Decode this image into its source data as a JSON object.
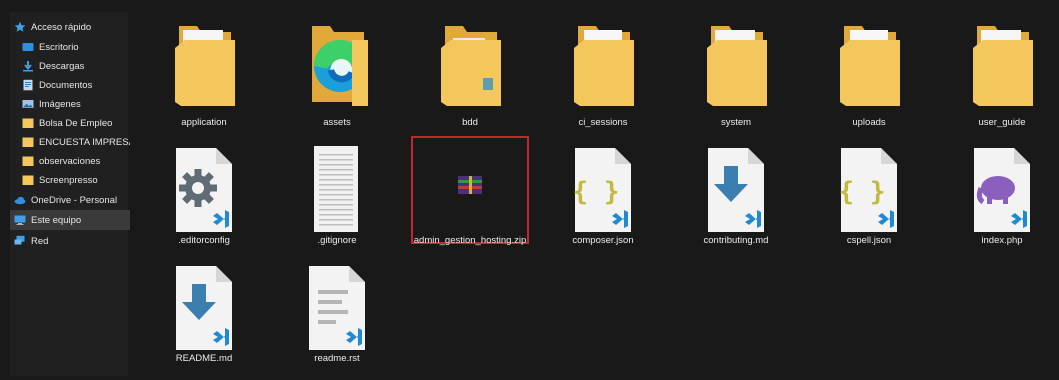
{
  "sidebar": {
    "items": [
      {
        "label": "Acceso rápido",
        "icon": "star-icon",
        "pinned": false
      },
      {
        "label": "Escritorio",
        "icon": "desktop-folder-icon",
        "pinned": true
      },
      {
        "label": "Descargas",
        "icon": "download-folder-icon",
        "pinned": true
      },
      {
        "label": "Documentos",
        "icon": "documents-folder-icon",
        "pinned": true
      },
      {
        "label": "Imágenes",
        "icon": "pictures-folder-icon",
        "pinned": true
      },
      {
        "label": "Bolsa De Empleo",
        "icon": "folder-icon",
        "pinned": false
      },
      {
        "label": "ENCUESTA IMPRESA",
        "icon": "folder-icon",
        "pinned": false
      },
      {
        "label": "observaciones",
        "icon": "folder-icon",
        "pinned": false
      },
      {
        "label": "Screenpresso",
        "icon": "folder-icon",
        "pinned": false
      },
      {
        "label": "OneDrive - Personal",
        "icon": "cloud-icon",
        "pinned": false
      },
      {
        "label": "Este equipo",
        "icon": "computer-icon",
        "pinned": false,
        "selected": true
      },
      {
        "label": "Red",
        "icon": "network-icon",
        "pinned": false
      }
    ],
    "pin_glyph": "✱"
  },
  "files": [
    {
      "name": "application",
      "type": "folder-edge"
    },
    {
      "name": "assets",
      "type": "folder-edge-big"
    },
    {
      "name": "bdd",
      "type": "folder-doc"
    },
    {
      "name": "ci_sessions",
      "type": "folder-plain"
    },
    {
      "name": "system",
      "type": "folder-edge"
    },
    {
      "name": "uploads",
      "type": "folder-plain"
    },
    {
      "name": "user_guide",
      "type": "folder-edge"
    },
    {
      "name": ".editorconfig",
      "type": "file-gear"
    },
    {
      "name": ".gitignore",
      "type": "file-text"
    },
    {
      "name": "admin_gestion_hosting.zip",
      "type": "winrar",
      "selected": true
    },
    {
      "name": "composer.json",
      "type": "file-json"
    },
    {
      "name": "contributing.md",
      "type": "file-md"
    },
    {
      "name": "cspell.json",
      "type": "file-json"
    },
    {
      "name": "index.php",
      "type": "file-php"
    },
    {
      "name": "README.md",
      "type": "file-md"
    },
    {
      "name": "readme.rst",
      "type": "file-lines"
    }
  ],
  "colors": {
    "folder": "#f3c75c",
    "folder_back": "#e0a93a",
    "vscode": "#1f8ad2",
    "selection": "#c1272d",
    "gear": "#5f6b75",
    "json": "#c0bb3a",
    "md_arrow": "#3b7fb0",
    "php": "#8a5fbe"
  }
}
